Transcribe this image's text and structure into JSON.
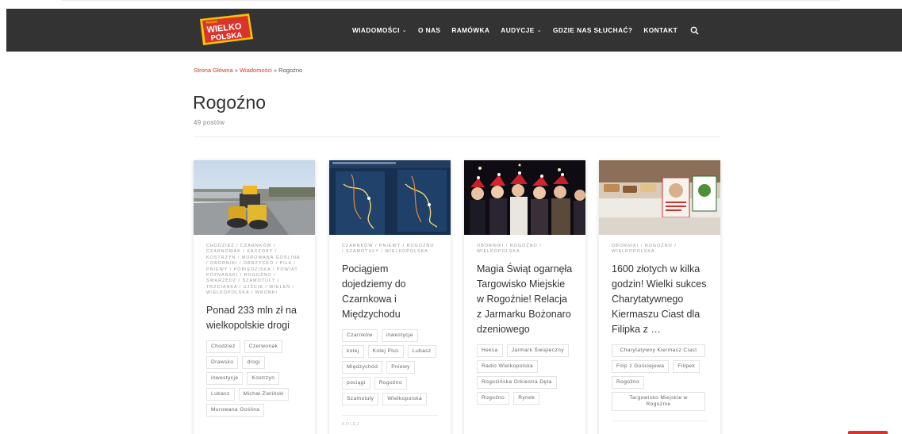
{
  "header": {
    "logo": {
      "line1": "RADIO",
      "line2": "WIELKO",
      "line3": "POLSKA"
    },
    "nav": [
      {
        "label": "WIADOMOŚCI",
        "dropdown": true
      },
      {
        "label": "O NAS",
        "dropdown": false
      },
      {
        "label": "RAMÓWKA",
        "dropdown": false
      },
      {
        "label": "AUDYCJE",
        "dropdown": true
      },
      {
        "label": "GDZIE NAS SŁUCHAĆ?",
        "dropdown": false
      },
      {
        "label": "KONTAKT",
        "dropdown": false
      }
    ],
    "search_icon": "search-icon",
    "chevron": "⌄"
  },
  "breadcrumb": {
    "home": "Strona Główna",
    "sep": " » ",
    "section": "Wiadomości",
    "current": "Rogoźno"
  },
  "page": {
    "title": "Rogoźno",
    "post_count": "49 postów"
  },
  "posts": [
    {
      "categories": "CHODZIEŻ / CZARNKÓW / CZARNOWAK / KACZORY / KOSTRZYN / MUROWANA GOŚLINA / OBORNIKI / OBRZYCKO / PIŁA / PNIEWY / POBIEDZISKA / POWIAT POZNAŃSKI / ROGOŹNO / SWARZĘDZ / SZAMOTUŁY / TRZCIANKA / UJŚCIE / WIELEŃ / WIELKOPOLSKA / WRONKI",
      "title": "Ponad 233 mln zł na wielkopolskie drogi",
      "tags": [
        "Chodzież",
        "Czerwonak",
        "Drawsko",
        "drogi",
        "inwestycje",
        "Kostrzyn",
        "Lubasz",
        "Michał Zieliński",
        "Murowana Goślina"
      ]
    },
    {
      "categories": "CZARNKÓW / PNIEWY / ROGOŹNO / SZAMOTUŁY / WIELKOPOLSKA",
      "title": "Pociągiem dojedziemy do Czarnkowa i Międzychodu",
      "tags": [
        "Czarnków",
        "inwestycje",
        "kolej",
        "Kolej Plus",
        "Lubasz",
        "Międzychód",
        "Pniewy",
        "pociągi",
        "Rogoźno",
        "Szamotuły",
        "Wielkopolska"
      ],
      "more": "KOLEJ"
    },
    {
      "categories": "OBORNIKI / ROGOŹNO / WIELKOPOLSKA",
      "title": "Magia Świąt ogarnęła Targowisko Miejskie w Rogoźnie! Relacja z Jarmarku Bożonarodzeniowego",
      "tags": [
        "Heksa",
        "Jarmark Świąteczny",
        "Radio Wielkopolska",
        "Rogozińska Orkiestra Dęta",
        "Rogoźno",
        "Rynek"
      ]
    },
    {
      "categories": "OBORNIKI / ROGOŹNO / WIELKOPOLSKA",
      "title": "1600 złotych w kilka godzin! Wielki sukces Charytatywnego Kiermaszu Ciast dla Filipka z …",
      "tags": [
        "Charytatywny Kiermasz Ciast",
        "Filip z Gościejewa",
        "Filipek",
        "Rogoźno",
        "Targowisko Miejskie w Rogoźnie"
      ]
    }
  ],
  "colors": {
    "header_bg": "#333333",
    "accent": "#d9332a",
    "logo_yellow": "#f5c400"
  }
}
